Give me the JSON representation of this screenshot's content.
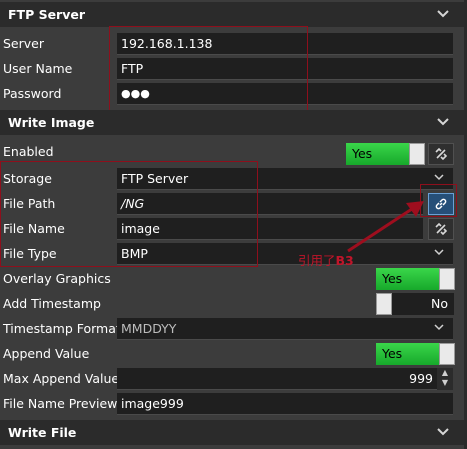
{
  "sections": {
    "ftp_server": {
      "title": "FTP Server"
    },
    "write_image": {
      "title": "Write Image"
    },
    "write_file": {
      "title": "Write File"
    }
  },
  "ftp": {
    "server_label": "Server",
    "server_value": "192.168.1.138",
    "username_label": "User Name",
    "username_value": "FTP",
    "password_label": "Password",
    "password_value": "●●●"
  },
  "write_image": {
    "enabled_label": "Enabled",
    "enabled_value": "Yes",
    "storage_label": "Storage",
    "storage_value": "FTP Server",
    "file_path_label": "File Path",
    "file_path_value": "/NG",
    "file_name_label": "File Name",
    "file_name_value": "image",
    "file_type_label": "File Type",
    "file_type_value": "BMP",
    "overlay_label": "Overlay Graphics",
    "overlay_value": "Yes",
    "timestamp_label": "Add Timestamp",
    "timestamp_value": "No",
    "timestamp_format_label": "Timestamp Format",
    "timestamp_format_value": "MMDDYY",
    "append_label": "Append Value",
    "append_value": "Yes",
    "max_append_label": "Max Append Value",
    "max_append_value": "999",
    "preview_label": "File Name Preview",
    "preview_value": "image999"
  },
  "annotation": {
    "text": "引用了",
    "bold": "B3"
  },
  "colors": {
    "toggle_on": "#22b534",
    "highlight_border": "#8e0f1c",
    "link_active": "#264f78"
  },
  "icons": [
    "chevron-down-icon",
    "link-icon",
    "unlink-icon",
    "caret-down-icon"
  ]
}
